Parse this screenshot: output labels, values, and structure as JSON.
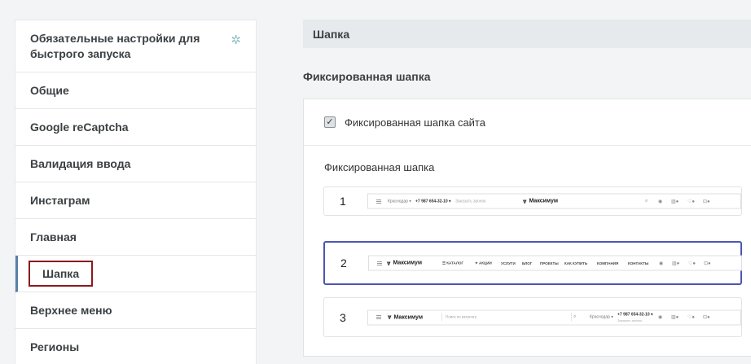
{
  "sidebar": {
    "items": [
      {
        "label": "Обязательные настройки для быстрого запуска",
        "starred": true
      },
      {
        "label": "Общие"
      },
      {
        "label": "Google reCaptcha"
      },
      {
        "label": "Валидация ввода"
      },
      {
        "label": "Инстаграм"
      },
      {
        "label": "Главная"
      },
      {
        "label": "Шапка",
        "active": true
      },
      {
        "label": "Верхнее меню"
      },
      {
        "label": "Регионы"
      }
    ],
    "star_icon": "✲"
  },
  "main": {
    "section_title": "Шапка",
    "group_title": "Фиксированная шапка",
    "checkbox": {
      "label": "Фиксированная шапка сайта",
      "checked": true
    },
    "options_title": "Фиксированная шапка",
    "options": [
      {
        "number": "1",
        "selected": false,
        "city": "Краснодар ▾",
        "phone": "+7 987 654-32-10 ▾",
        "callback": "Заказать звонок",
        "logo": "Максимум"
      },
      {
        "number": "2",
        "selected": true,
        "logo": "Максимум",
        "menu": [
          "☰ КАТАЛОГ",
          "✦ АКЦИИ",
          "УСЛУГИ",
          "БЛОГ",
          "ПРОЕКТЫ",
          "КАК КУПИТЬ",
          "КОМПАНИЯ",
          "КОНТАКТЫ"
        ]
      },
      {
        "number": "3",
        "selected": false,
        "logo": "Максимум",
        "search_placeholder": "Поиск по каталогу",
        "city": "Краснодар ▾",
        "phone": "+7 987 654-32-10 ▾",
        "callback": "Заказать звонок"
      }
    ]
  }
}
